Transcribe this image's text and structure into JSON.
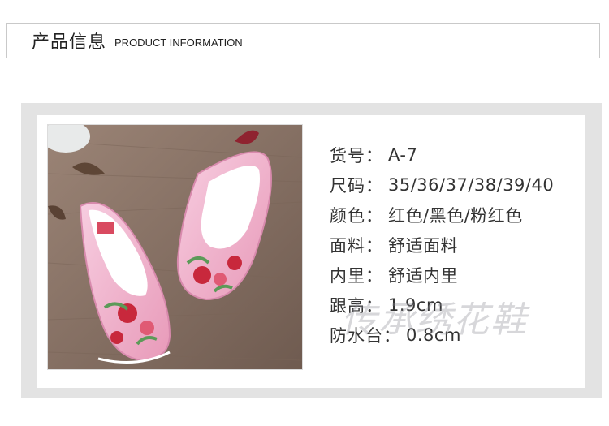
{
  "header": {
    "title_cn": "产品信息",
    "title_en": "PRODUCT INFORMATION"
  },
  "specs": [
    {
      "label": "货号：",
      "value": "A-7"
    },
    {
      "label": "尺码：",
      "value": "35/36/37/38/39/40"
    },
    {
      "label": "颜色：",
      "value": "红色/黑色/粉红色"
    },
    {
      "label": "面料：",
      "value": "舒适面料"
    },
    {
      "label": "内里：",
      "value": "舒适内里"
    },
    {
      "label": "跟高：",
      "value": "1.9cm"
    },
    {
      "label": "防水台：",
      "value": "0.8cm"
    }
  ],
  "watermark": "传承绣花鞋",
  "product_image": {
    "subject": "pink-embroidered-flat-shoes",
    "colors": {
      "shoe": "#f1b8d3",
      "background_cloth": "#8c7466",
      "embroidery_red": "#c8283c",
      "embroidery_green": "#5c9a58"
    }
  }
}
